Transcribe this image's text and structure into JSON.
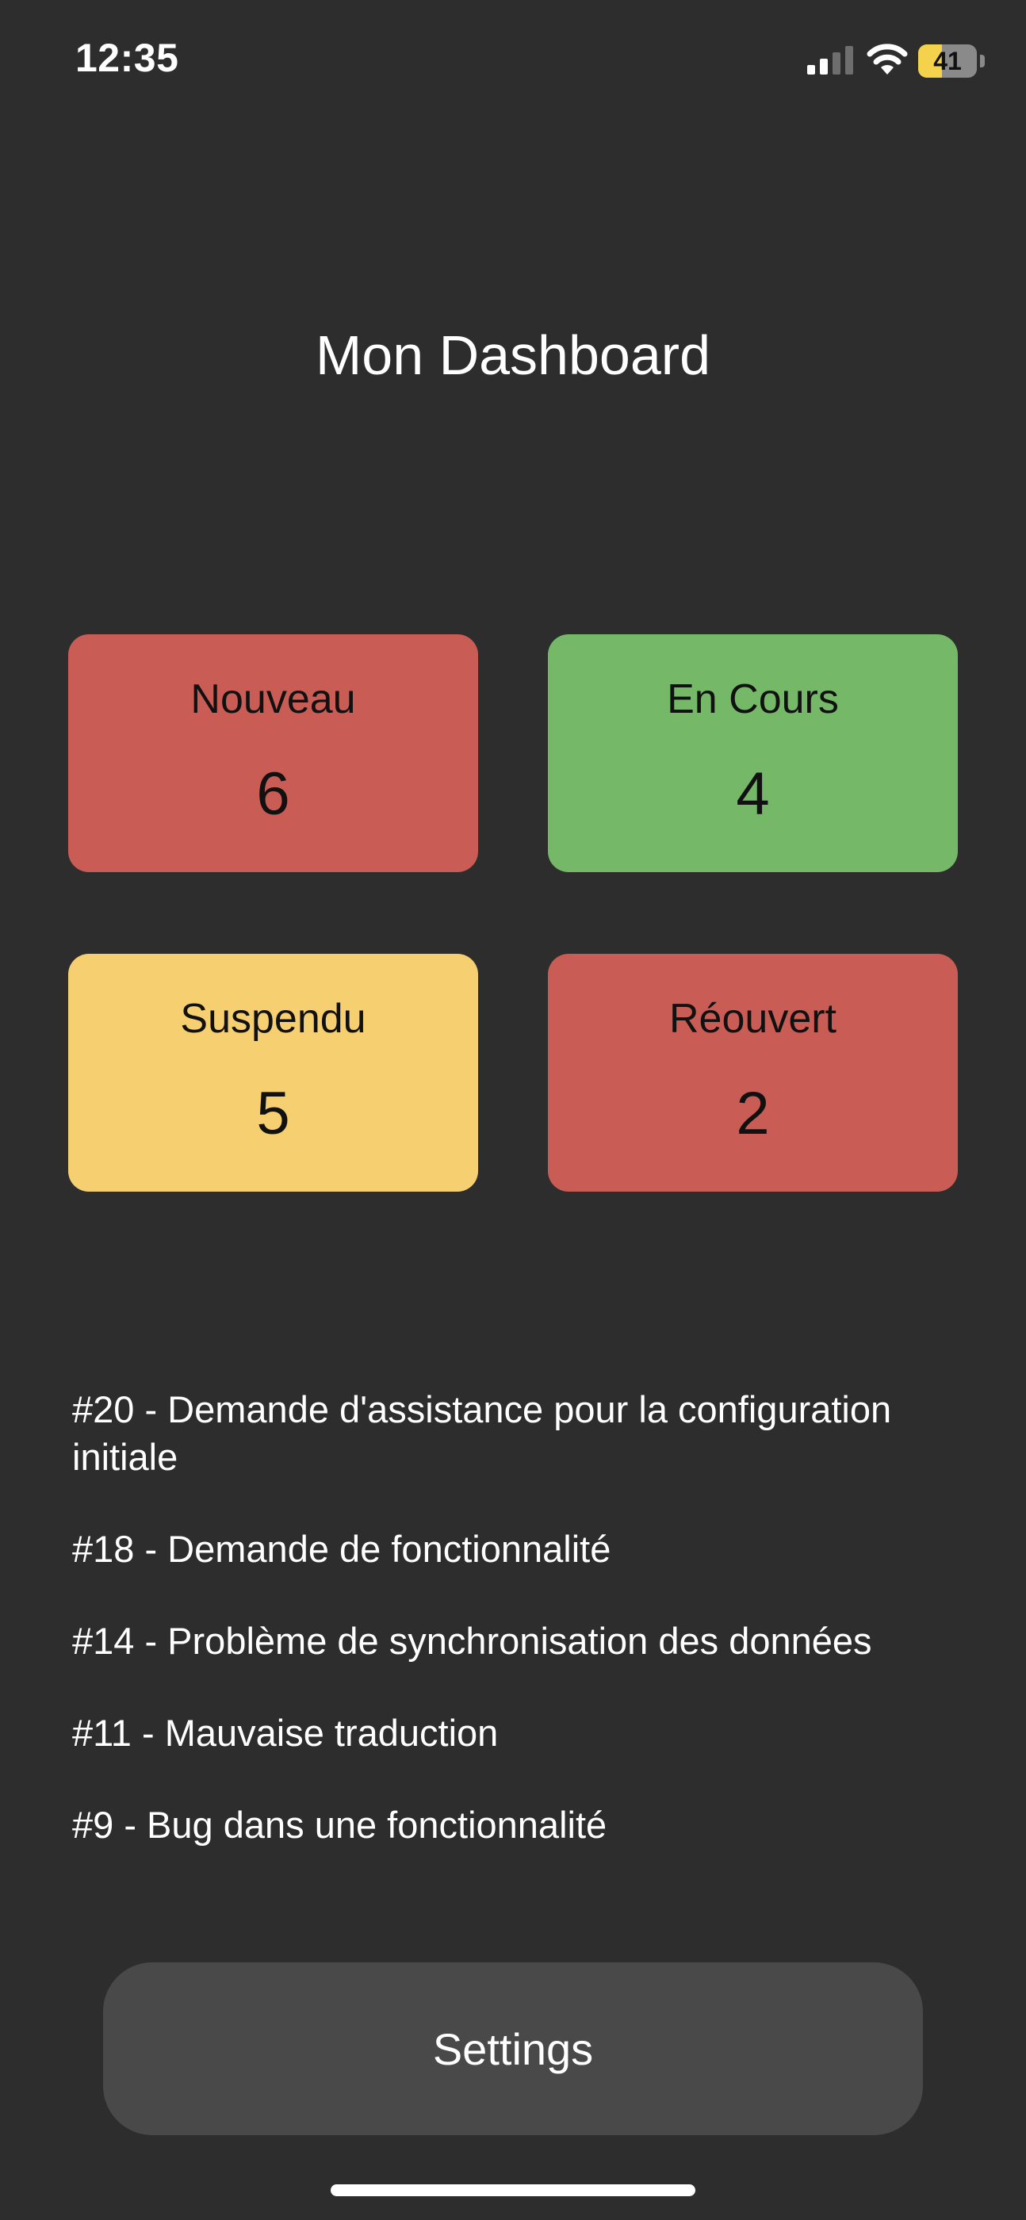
{
  "status_bar": {
    "time": "12:35",
    "battery_level": "41",
    "battery_fraction": 0.41
  },
  "colors": {
    "background": "#2d2d2d",
    "status_red": "#c95c54",
    "status_green": "#74b868",
    "status_yellow": "#f6cf70",
    "button_bg": "#494949",
    "battery_yellow": "#f5d24b"
  },
  "dashboard": {
    "title": "Mon Dashboard",
    "cards": [
      {
        "label": "Nouveau",
        "count": "6",
        "color": "#c95c54"
      },
      {
        "label": "En Cours",
        "count": "4",
        "color": "#74b868"
      },
      {
        "label": "Suspendu",
        "count": "5",
        "color": "#f6cf70"
      },
      {
        "label": "Réouvert",
        "count": "2",
        "color": "#c95c54"
      }
    ]
  },
  "tickets": [
    "#20 - Demande d'assistance pour la configuration initiale",
    "#18 - Demande de fonctionnalité",
    "#14 - Problème de synchronisation des données",
    "#11 - Mauvaise traduction",
    "#9 - Bug dans une fonctionnalité"
  ],
  "settings_button": {
    "label": "Settings"
  },
  "icons": {
    "signal": "cellular-signal-icon",
    "wifi": "wifi-icon",
    "battery": "battery-icon"
  }
}
